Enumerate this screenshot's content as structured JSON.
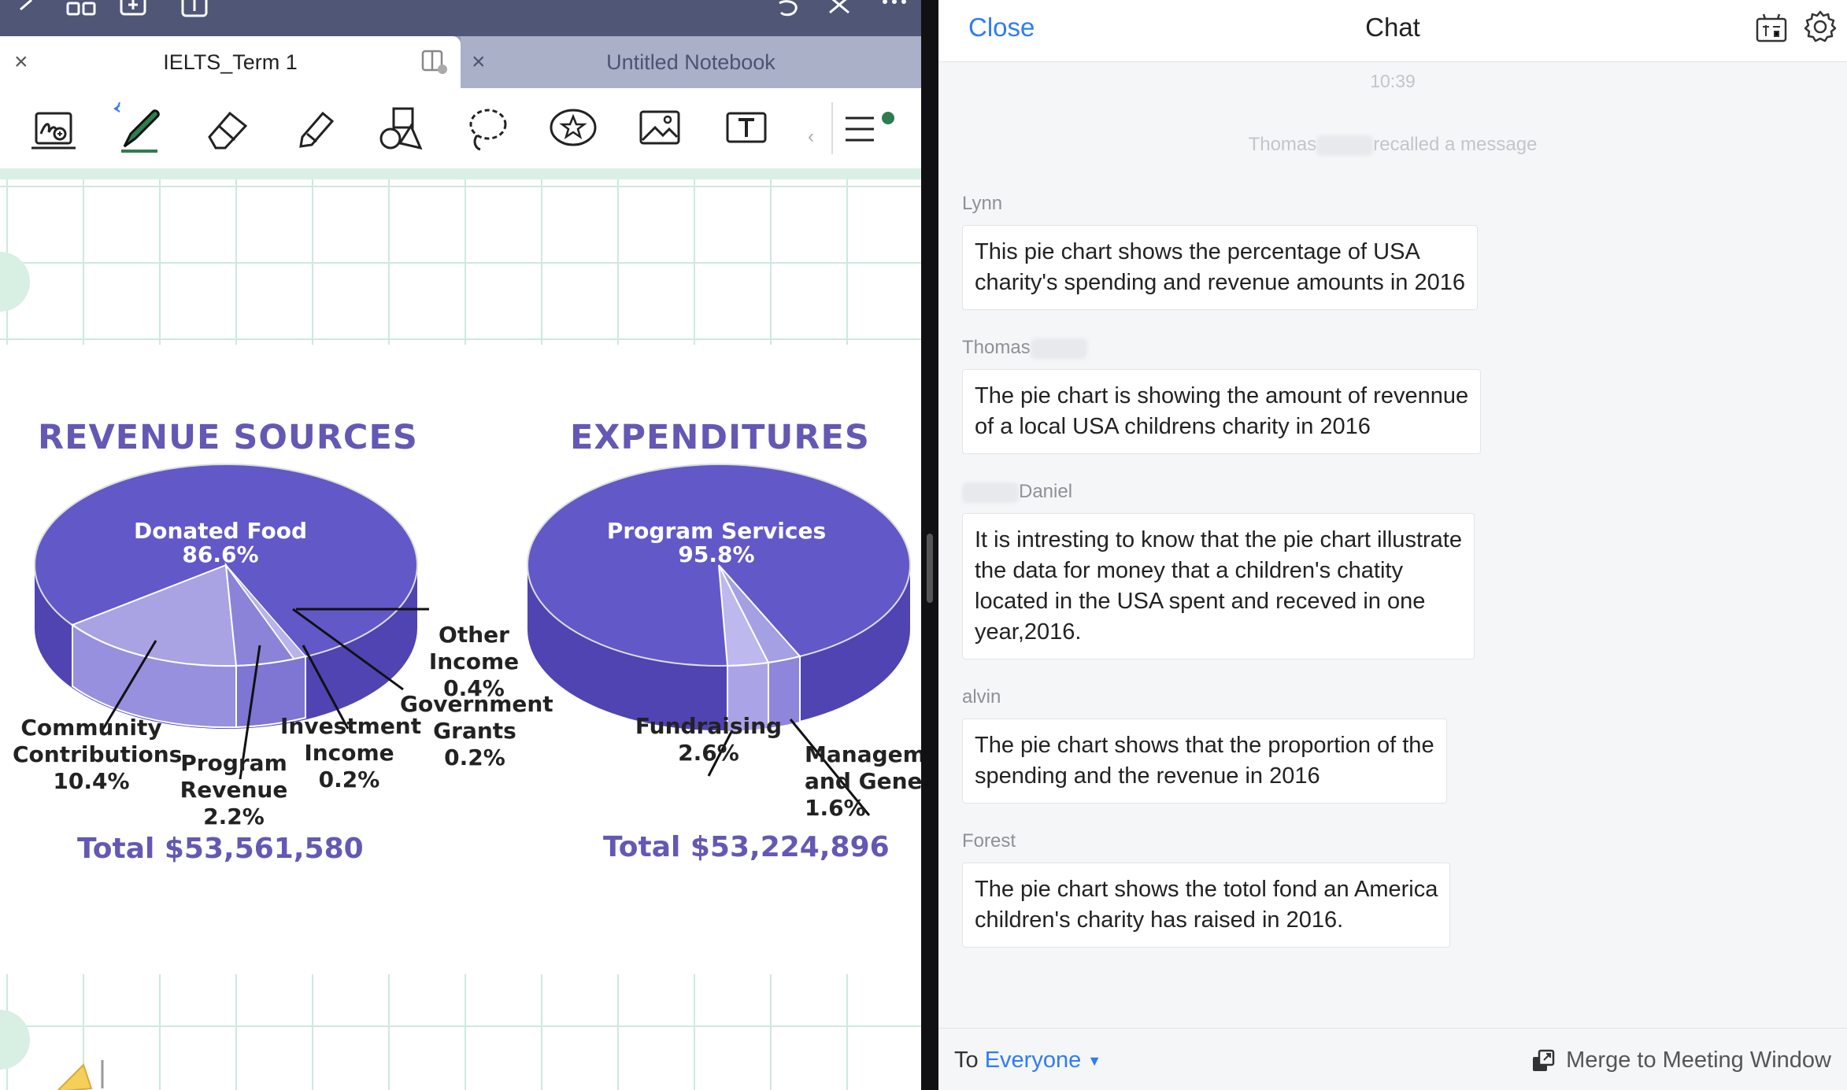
{
  "notes_app": {
    "tabs": [
      {
        "label": "IELTS_Term 1",
        "active": true
      },
      {
        "label": "Untitled Notebook",
        "active": false
      }
    ],
    "toolbar_tools": [
      "zoom-writing-icon",
      "pen-icon",
      "eraser-icon",
      "highlighter-icon",
      "shapes-icon",
      "lasso-icon",
      "sticker-icon",
      "image-icon",
      "text-box-icon",
      "more-menu-icon"
    ],
    "colors": {
      "titlebar": "#4f5676",
      "accent_green": "#2e7d4f",
      "pen_blue": "#2e7cf6"
    },
    "chart_image": {
      "revenue_title": "REVENUE SOURCES",
      "expenditures_title": "EXPENDITURES",
      "revenue_total": "Total $53,561,580",
      "expenditures_total": "Total $53,224,896",
      "revenue_labels": {
        "donated_food": "Donated Food",
        "donated_food_pct": "86.6%",
        "other_income": "Other\nIncome\n0.4%",
        "government_grants": "Government\nGrants\n0.2%",
        "investment_income": "Investment\nIncome\n0.2%",
        "program_revenue": "Program\nRevenue\n2.2%",
        "community_contributions": "Community\nContributions\n10.4%"
      },
      "expenditure_labels": {
        "program_services": "Program Services",
        "program_services_pct": "95.8%",
        "fundraising": "Fundraising\n2.6%",
        "management": "Managem\nand Gene\n1.6%"
      }
    }
  },
  "chart_data": [
    {
      "type": "pie",
      "title": "REVENUE SOURCES",
      "categories": [
        "Donated Food",
        "Community Contributions",
        "Program Revenue",
        "Investment Income",
        "Government Grants",
        "Other Income"
      ],
      "values": [
        86.6,
        10.4,
        2.2,
        0.2,
        0.2,
        0.4
      ],
      "total": "Total $53,561,580"
    },
    {
      "type": "pie",
      "title": "EXPENDITURES",
      "categories": [
        "Program Services",
        "Fundraising",
        "Managem and Gene"
      ],
      "values": [
        95.8,
        2.6,
        1.6
      ],
      "total": "Total $53,224,896"
    }
  ],
  "chat": {
    "close_label": "Close",
    "title": "Chat",
    "timestamp": "10:39",
    "recall_sender": "Thomas",
    "recall_text": "recalled a message",
    "messages": [
      {
        "sender": "Lynn",
        "text": "This pie chart shows the percentage of USA\ncharity's spending and revenue amounts in 2016"
      },
      {
        "sender": "Thomas",
        "text": "The pie chart is showing the amount of revennue\nof a local USA childrens charity in 2016"
      },
      {
        "sender": "Daniel",
        "text": "It is intresting to know that the pie chart illustrate\nthe data for money that a children's chatity\nlocated in the USA spent and receved in one\nyear,2016."
      },
      {
        "sender": "alvin",
        "text": "The pie chart shows that the proportion of the\nspending and the revenue in 2016"
      },
      {
        "sender": "Forest",
        "text": "The pie chart shows the totol fond an America\nchildren's charity has raised in 2016."
      }
    ],
    "footer": {
      "to_prefix": "To",
      "to_value": "Everyone",
      "merge_label": "Merge to Meeting Window"
    },
    "colors": {
      "link_blue": "#2e7cf6",
      "muted": "#8e9096"
    }
  }
}
